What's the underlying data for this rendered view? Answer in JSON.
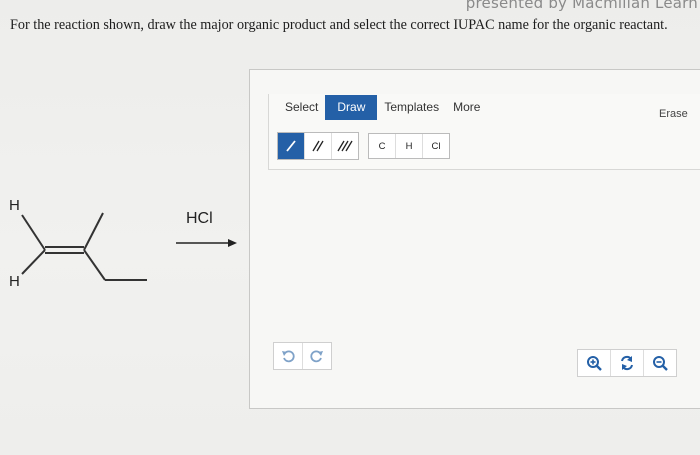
{
  "header": {
    "brand_fragment": "presented by Macmillan Learn"
  },
  "question": {
    "text": "For the reaction shown, draw the major organic product and select the correct IUPAC name for the organic reactant."
  },
  "reaction": {
    "reactant_atoms": {
      "top_h": "H",
      "bottom_h": "H"
    },
    "reagent": "HCl"
  },
  "editor": {
    "tabs": [
      {
        "label": "Select"
      },
      {
        "label": "Draw"
      },
      {
        "label": "Templates"
      },
      {
        "label": "More"
      }
    ],
    "active_tab": "Draw",
    "erase_label": "Erase",
    "bond_tools": [
      {
        "label": "/",
        "icon": "single-bond-icon"
      },
      {
        "label": "//",
        "icon": "double-bond-icon"
      },
      {
        "label": "///",
        "icon": "triple-bond-icon"
      }
    ],
    "atom_tools": [
      {
        "label": "C"
      },
      {
        "label": "H"
      },
      {
        "label": "Cl"
      }
    ],
    "history_icons": [
      "undo-icon",
      "redo-icon"
    ],
    "zoom_icons": [
      "zoom-in-icon",
      "reset-zoom-icon",
      "zoom-out-icon"
    ],
    "accent_color": "#2460a7"
  }
}
